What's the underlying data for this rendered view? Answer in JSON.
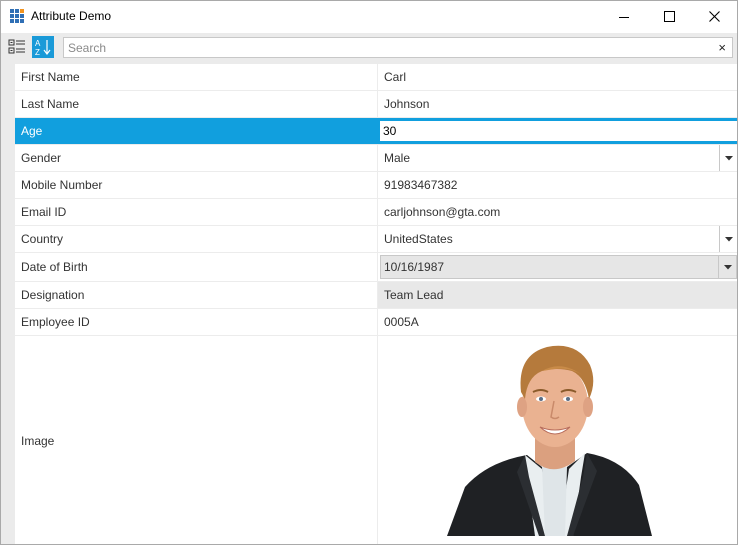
{
  "window": {
    "title": "Attribute Demo"
  },
  "toolbar": {
    "categorized_icon": "categorized-view-icon",
    "alphabetical_icon": "sort-alphabetical-icon",
    "search_placeholder": "Search",
    "clear_glyph": "×"
  },
  "properties": [
    {
      "name": "First Name",
      "value": "Carl"
    },
    {
      "name": "Last Name",
      "value": "Johnson"
    },
    {
      "name": "Age",
      "value": "30"
    },
    {
      "name": "Gender",
      "value": "Male"
    },
    {
      "name": "Mobile Number",
      "value": "91983467382"
    },
    {
      "name": "Email ID",
      "value": "carljohnson@gta.com"
    },
    {
      "name": "Country",
      "value": "UnitedStates"
    },
    {
      "name": "Date of Birth",
      "value": "10/16/1987"
    },
    {
      "name": "Designation",
      "value": "Team Lead"
    },
    {
      "name": "Employee ID",
      "value": "0005A"
    },
    {
      "name": "Image",
      "value": ""
    }
  ],
  "colors": {
    "accent": "#119fde",
    "toolbar_bg": "#ebebeb",
    "disabled_bg": "#e8e8e8"
  }
}
